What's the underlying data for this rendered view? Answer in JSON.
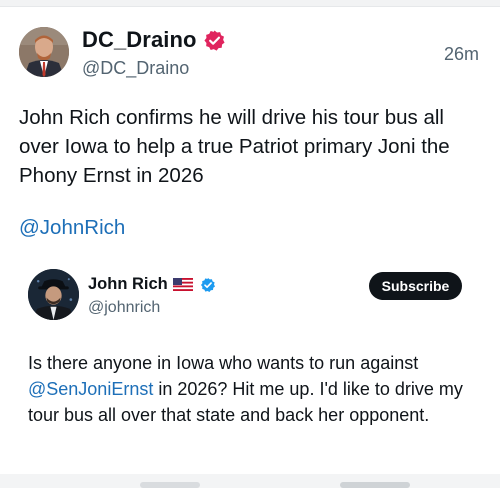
{
  "post": {
    "author_name": "DC_Draino",
    "handle": "@DC_Draino",
    "time": "26m",
    "text": "John Rich confirms he will drive his tour bus all over Iowa to help a true Patriot primary Joni the Phony Ernst in 2026",
    "mention": "@JohnRich"
  },
  "quoted": {
    "author_name": "John Rich",
    "handle": "@johnrich",
    "subscribe_label": "Subscribe",
    "text_before": "Is there anyone in Iowa who wants to run against ",
    "text_mention": "@SenJoniErnst",
    "text_after": " in 2026? Hit me up. I'd like to drive my tour bus all over that state and back her opponent."
  },
  "icons": {
    "author_badge": "verified-badge-icon",
    "flag": "us-flag-icon",
    "quoted_badge": "verified-check-icon"
  },
  "colors": {
    "text": "#0f1419",
    "secondary": "#536471",
    "link": "#1d6fb8",
    "badge_red": "#e0245e",
    "badge_blue": "#1d9bf0",
    "button_bg": "#0f1419"
  }
}
